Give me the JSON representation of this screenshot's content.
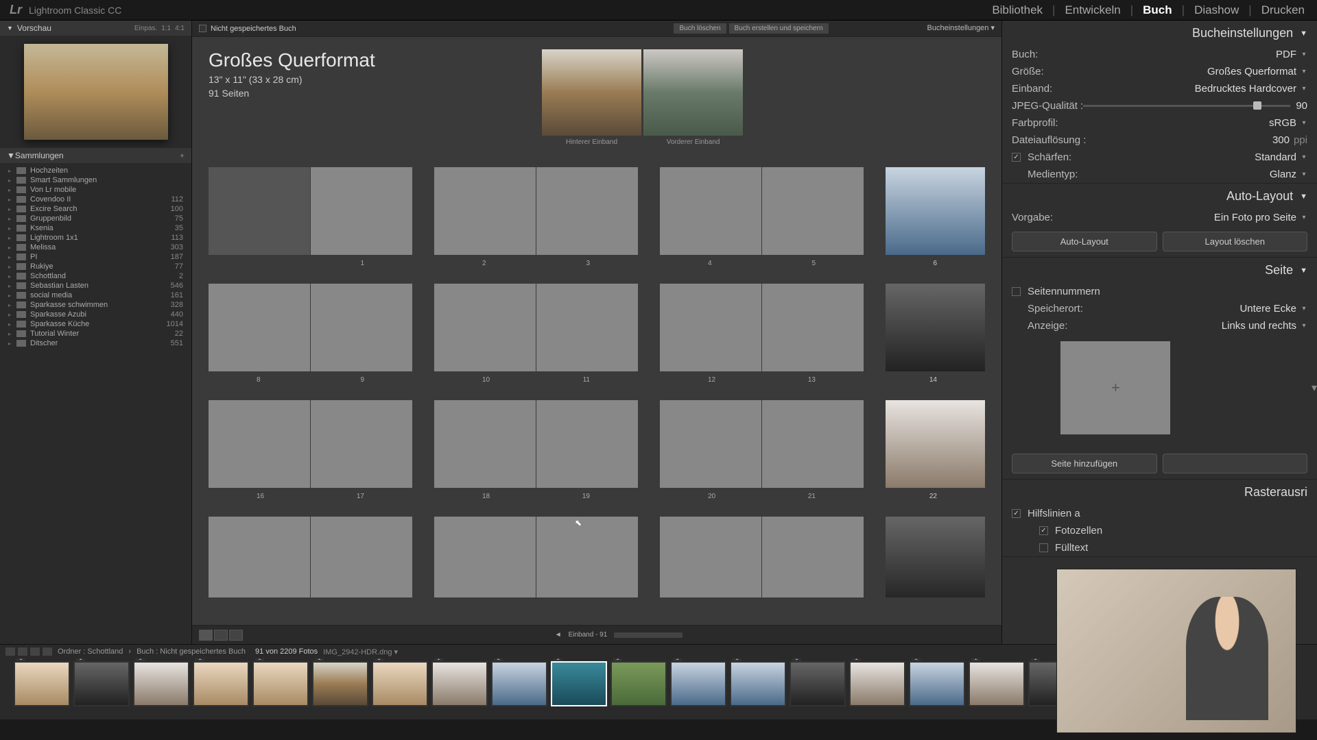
{
  "app": {
    "logo": "Lr",
    "name": "Lightroom Classic CC"
  },
  "modules": {
    "items": [
      "Bibliothek",
      "Entwickeln",
      "Buch",
      "Diashow",
      "Drucken"
    ],
    "active": 2
  },
  "left": {
    "preview_label": "Vorschau",
    "preview_opts": [
      "Einpas.",
      "1:1",
      "4:1"
    ],
    "collections_label": "Sammlungen",
    "collections": [
      {
        "name": "Hochzeiten",
        "count": ""
      },
      {
        "name": "Smart Sammlungen",
        "count": ""
      },
      {
        "name": "Von Lr mobile",
        "count": ""
      },
      {
        "name": "Covendoo II",
        "count": "112"
      },
      {
        "name": "Excire Search",
        "count": "100"
      },
      {
        "name": "Gruppenbild",
        "count": "75"
      },
      {
        "name": "Ksenia",
        "count": "35"
      },
      {
        "name": "Lightroom 1x1",
        "count": "113"
      },
      {
        "name": "Melissa",
        "count": "303"
      },
      {
        "name": "PI",
        "count": "187"
      },
      {
        "name": "Rukiye",
        "count": "77"
      },
      {
        "name": "Schottland",
        "count": "2"
      },
      {
        "name": "Sebastian Lasten",
        "count": "546"
      },
      {
        "name": "social media",
        "count": "161"
      },
      {
        "name": "Sparkasse schwimmen",
        "count": "328"
      },
      {
        "name": "Sparkasse Azubi",
        "count": "440"
      },
      {
        "name": "Sparkasse Küche",
        "count": "1014"
      },
      {
        "name": "Tutorial Winter",
        "count": "22"
      },
      {
        "name": "Ditscher",
        "count": "551"
      }
    ]
  },
  "center": {
    "unsaved": "Nicht gespeichertes Buch",
    "btn_delete": "Buch löschen",
    "btn_save": "Buch erstellen und speichern",
    "settings_link": "Bucheinstellungen ▾",
    "title": "Großes Querformat",
    "dims": "13\" x 11\" (33 x 28 cm)",
    "pages": "91 Seiten",
    "cover_back": "Hinterer Einband",
    "cover_front": "Vorderer Einband",
    "nav_label": "Einband - 91"
  },
  "right": {
    "s1_title": "Bucheinstellungen",
    "book_lbl": "Buch:",
    "book_val": "PDF",
    "size_lbl": "Größe:",
    "size_val": "Großes Querformat",
    "cover_lbl": "Einband:",
    "cover_val": "Bedrucktes Hardcover",
    "jpeg_lbl": "JPEG-Qualität :",
    "jpeg_val": "90",
    "profile_lbl": "Farbprofil:",
    "profile_val": "sRGB",
    "res_lbl": "Dateiauflösung :",
    "res_val": "300",
    "res_unit": "ppi",
    "sharpen_lbl": "Schärfen:",
    "sharpen_val": "Standard",
    "media_lbl": "Medientyp:",
    "media_val": "Glanz",
    "s2_title": "Auto-Layout",
    "preset_lbl": "Vorgabe:",
    "preset_val": "Ein Foto pro Seite",
    "btn_auto": "Auto-Layout",
    "btn_clear": "Layout löschen",
    "s3_title": "Seite",
    "pagenum_lbl": "Seitennummern",
    "loc_lbl": "Speicherort:",
    "loc_val": "Untere Ecke",
    "disp_lbl": "Anzeige:",
    "disp_val": "Links und rechts",
    "btn_addpage": "Seite hinzufügen",
    "s4_title": "Rasterausri",
    "guides_lbl": "Hilfslinien a",
    "photocells_lbl": "Fotozellen",
    "fulltext_lbl": "Fülltext"
  },
  "filmstrip": {
    "path1": "Ordner : Schottland",
    "path2": "Buch : Nicht gespeichertes Buch",
    "count": "91 von 2209 Fotos",
    "file": "IMG_2942-HDR.dng ▾"
  },
  "page_numbers": [
    "1",
    "2",
    "3",
    "4",
    "5",
    "6",
    "8",
    "9",
    "10",
    "11",
    "12",
    "13",
    "14",
    "16",
    "17",
    "18",
    "19",
    "20",
    "21",
    "22"
  ]
}
